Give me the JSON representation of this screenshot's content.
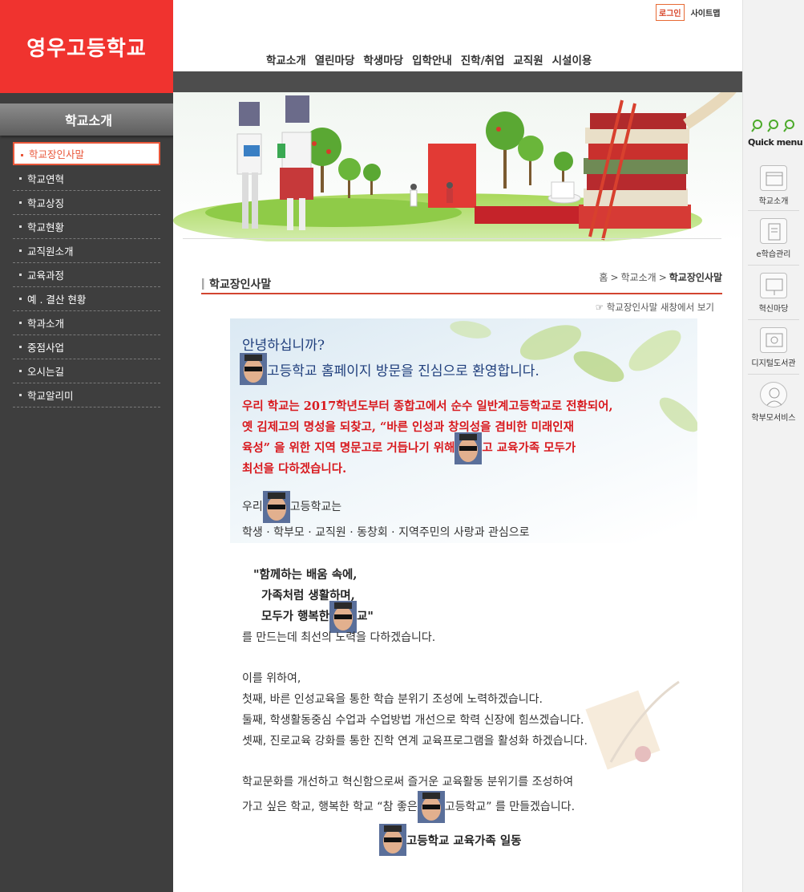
{
  "school": {
    "logo_text": "영우고등학교"
  },
  "top": {
    "login_label": "로그인",
    "sitemap_label": "사이트맵"
  },
  "gnb": [
    "학교소개",
    "열린마당",
    "학생마당",
    "입학안내",
    "진학/취업",
    "교직원",
    "시설이용"
  ],
  "sidebar": {
    "title": "학교소개",
    "items": [
      {
        "label": "학교장인사말",
        "active": true
      },
      {
        "label": "학교연혁"
      },
      {
        "label": "학교상징"
      },
      {
        "label": "학교현황"
      },
      {
        "label": "교직원소개"
      },
      {
        "label": "교육과정"
      },
      {
        "label": "예 . 결산 현황"
      },
      {
        "label": "학과소개"
      },
      {
        "label": "중점사업"
      },
      {
        "label": "오시는길"
      },
      {
        "label": "학교알리미"
      }
    ]
  },
  "quick": {
    "title": "Quick menu",
    "items": [
      {
        "label": "학교소개",
        "icon": "calendar-icon"
      },
      {
        "label": "e학습관리",
        "icon": "document-icon"
      },
      {
        "label": "혁신마당",
        "icon": "presentation-icon"
      },
      {
        "label": "디지털도서관",
        "icon": "book-search-icon"
      },
      {
        "label": "학부모서비스",
        "icon": "headset-person-icon"
      }
    ]
  },
  "content": {
    "title": "학교장인사말",
    "breadcrumb": {
      "home": "홈",
      "section": "학교소개",
      "current": "학교장인사말"
    },
    "new_window": "☞ 학교장인사말 새창에서 보기",
    "greeting1": "안녕하십니까?",
    "greeting2": "고등학교 홈페이지 방문을 진심으로 환영합니다.",
    "red_para_a": "우리 학교는 2017학년도부터 종합고에서 순수 일반계고등학교로 전환되어,",
    "red_para_b": "옛 김제고의 명성을 되찾고, “바른 인성과 창의성을 겸비한 미래인재",
    "red_para_c": "육성” 을 위한 지역 명문고로 거듭나기 위해",
    "red_para_d": "고 교육가족 모두가",
    "red_para_e": "최선을 다하겠습니다.",
    "school_intro_a": "우리",
    "school_intro_b": "고등학교는",
    "community": "학생  ·  학부모  ·  교직원  ·  동창회  ·  지역주민의 사랑과 관심으로",
    "motto1": "\"함께하는 배움 속에,",
    "motto2": "가족처럼 생활하며,",
    "motto3a": "모두가 행복한",
    "motto3b": "교\"",
    "effort": "를 만드는데 최선의 노력을 다하겠습니다.",
    "plan_intro": "이를 위하여,",
    "plan1": "첫째, 바른 인성교육을 통한 학습 분위기 조성에 노력하겠습니다.",
    "plan2": "둘째, 학생활동중심 수업과 수업방법 개선으로 학력 신장에 힘쓰겠습니다.",
    "plan3": "셋째, 진로교육 강화를 통한 진학 연계 교육프로그램을 활성화 하겠습니다.",
    "closing1": "학교문화를 개선하고 혁신함으로써 즐거운 교육활동 분위기를 조성하여",
    "closing2a": "가고 싶은 학교, 행복한 학교  “참 좋은",
    "closing2b": "고등학교” 를 만들겠습니다.",
    "sign": "고등학교 교육가족 일동"
  }
}
